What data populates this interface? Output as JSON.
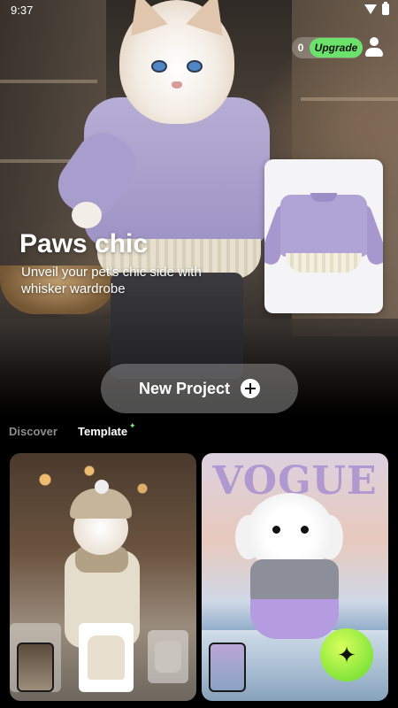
{
  "status_bar": {
    "time": "9:37"
  },
  "top": {
    "credits": "0",
    "upgrade_label": "Upgrade"
  },
  "hero": {
    "title": "Paws chic",
    "subtitle": "Unveil your pet's chic side with whisker wardrobe"
  },
  "actions": {
    "new_project_label": "New Project"
  },
  "tabs": [
    {
      "label": "Discover",
      "active": false
    },
    {
      "label": "Template",
      "active": true
    }
  ],
  "cards": [
    {
      "name": "cat-in-knit-outfit"
    },
    {
      "name": "dog-vogue-cover",
      "cover_text": "VOGUE"
    }
  ],
  "icons": {
    "wifi": "wifi-icon",
    "battery": "battery-icon",
    "profile": "profile-icon",
    "plus": "plus-icon",
    "sparkle": "sparkle-icon",
    "magic": "magic-sparkle-icon"
  },
  "colors": {
    "accent": "#6be36b",
    "tab_inactive": "#8c8c8c",
    "background": "#000000"
  }
}
